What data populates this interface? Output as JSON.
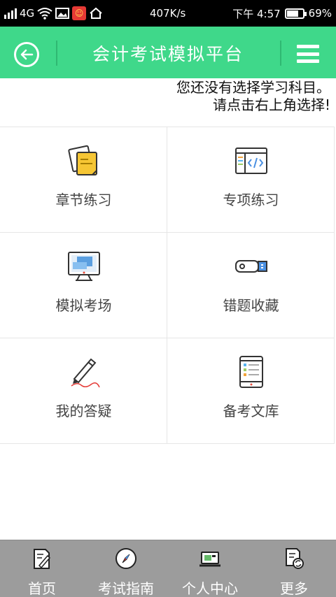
{
  "status_bar": {
    "network": "4G",
    "speed": "407K/s",
    "time": "下午 4:57",
    "battery_percent": "69%",
    "battery_level": 0.69,
    "icons": [
      "signal-icon",
      "wifi-icon",
      "image-icon",
      "app-badge-icon",
      "home-icon"
    ]
  },
  "header": {
    "title": "会计考试模拟平台",
    "back_icon": "back-arrow-icon",
    "menu_icon": "hamburger-menu-icon",
    "accent_color": "#3fd88a"
  },
  "notice": {
    "line1": "您还没有选择学习科目。",
    "line2": "请点击右上角选择!"
  },
  "grid": {
    "items": [
      {
        "label": "章节练习",
        "icon": "notes-icon"
      },
      {
        "label": "专项练习",
        "icon": "code-window-icon"
      },
      {
        "label": "模拟考场",
        "icon": "monitor-icon"
      },
      {
        "label": "错题收藏",
        "icon": "usb-drive-icon"
      },
      {
        "label": "我的答疑",
        "icon": "pen-icon"
      },
      {
        "label": "备考文库",
        "icon": "tablet-icon"
      }
    ]
  },
  "bottom_nav": {
    "background": "#9c9c9c",
    "items": [
      {
        "label": "首页",
        "icon": "document-pen-icon"
      },
      {
        "label": "考试指南",
        "icon": "compass-icon"
      },
      {
        "label": "个人中心",
        "icon": "laptop-icon"
      },
      {
        "label": "更多",
        "icon": "file-settings-icon"
      }
    ]
  }
}
